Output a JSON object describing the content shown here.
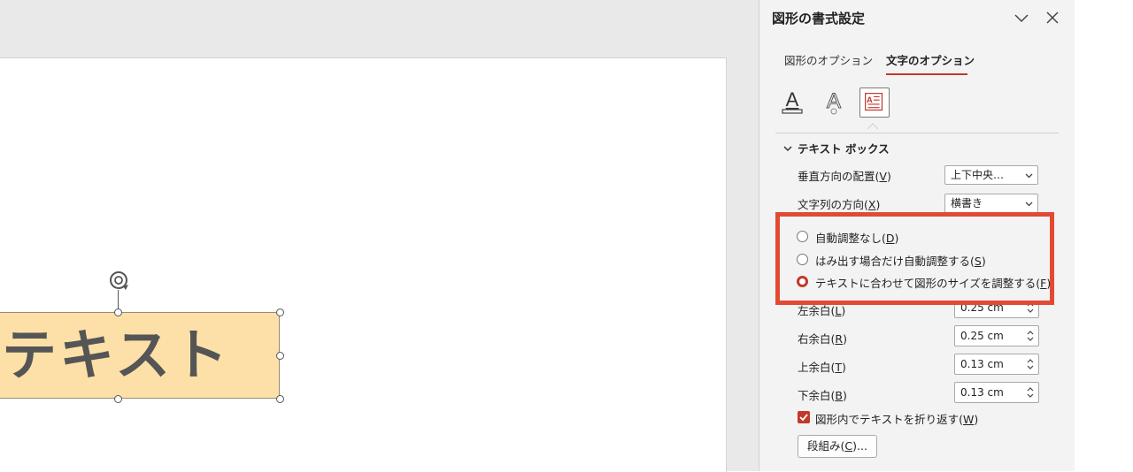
{
  "canvas": {
    "shape_text": "テキスト"
  },
  "pane": {
    "title": "図形の書式設定",
    "tabs": [
      {
        "label": "図形のオプション",
        "active": false
      },
      {
        "label": "文字のオプション",
        "active": true
      }
    ],
    "icons": [
      "text-fill-outline-icon",
      "text-effects-icon",
      "textbox-icon"
    ],
    "section": {
      "title": "テキスト ボックス",
      "vertical_alignment": {
        "label_pre": "垂直方向の配置(",
        "key": "V",
        "label_post": ")",
        "value": "上下中央…"
      },
      "text_direction": {
        "label_pre": "文字列の方向(",
        "key": "X",
        "label_post": ")",
        "value": "横書き"
      },
      "autofit_options": [
        {
          "pre": "自動調整なし(",
          "key": "D",
          "post": ")",
          "checked": false
        },
        {
          "pre": "はみ出す場合だけ自動調整する(",
          "key": "S",
          "post": ")",
          "checked": false
        },
        {
          "pre": "テキストに合わせて図形のサイズを調整する(",
          "key": "F",
          "post": ")",
          "checked": true
        }
      ],
      "margins": [
        {
          "pre": "左余白(",
          "key": "L",
          "post": ")",
          "value": "0.25 cm"
        },
        {
          "pre": "右余白(",
          "key": "R",
          "post": ")",
          "value": "0.25 cm"
        },
        {
          "pre": "上余白(",
          "key": "T",
          "post": ")",
          "value": "0.13 cm"
        },
        {
          "pre": "下余白(",
          "key": "B",
          "post": ")",
          "value": "0.13 cm"
        }
      ],
      "wrap_text": {
        "pre": "図形内でテキストを折り返す(",
        "key": "W",
        "post": ")",
        "checked": true
      },
      "columns_button": {
        "pre": "段組み(",
        "key": "C",
        "post": ")..."
      }
    }
  },
  "colors": {
    "accent": "#c0392b",
    "highlight_box": "#e24a33",
    "shape_fill": "#fde0a8"
  }
}
